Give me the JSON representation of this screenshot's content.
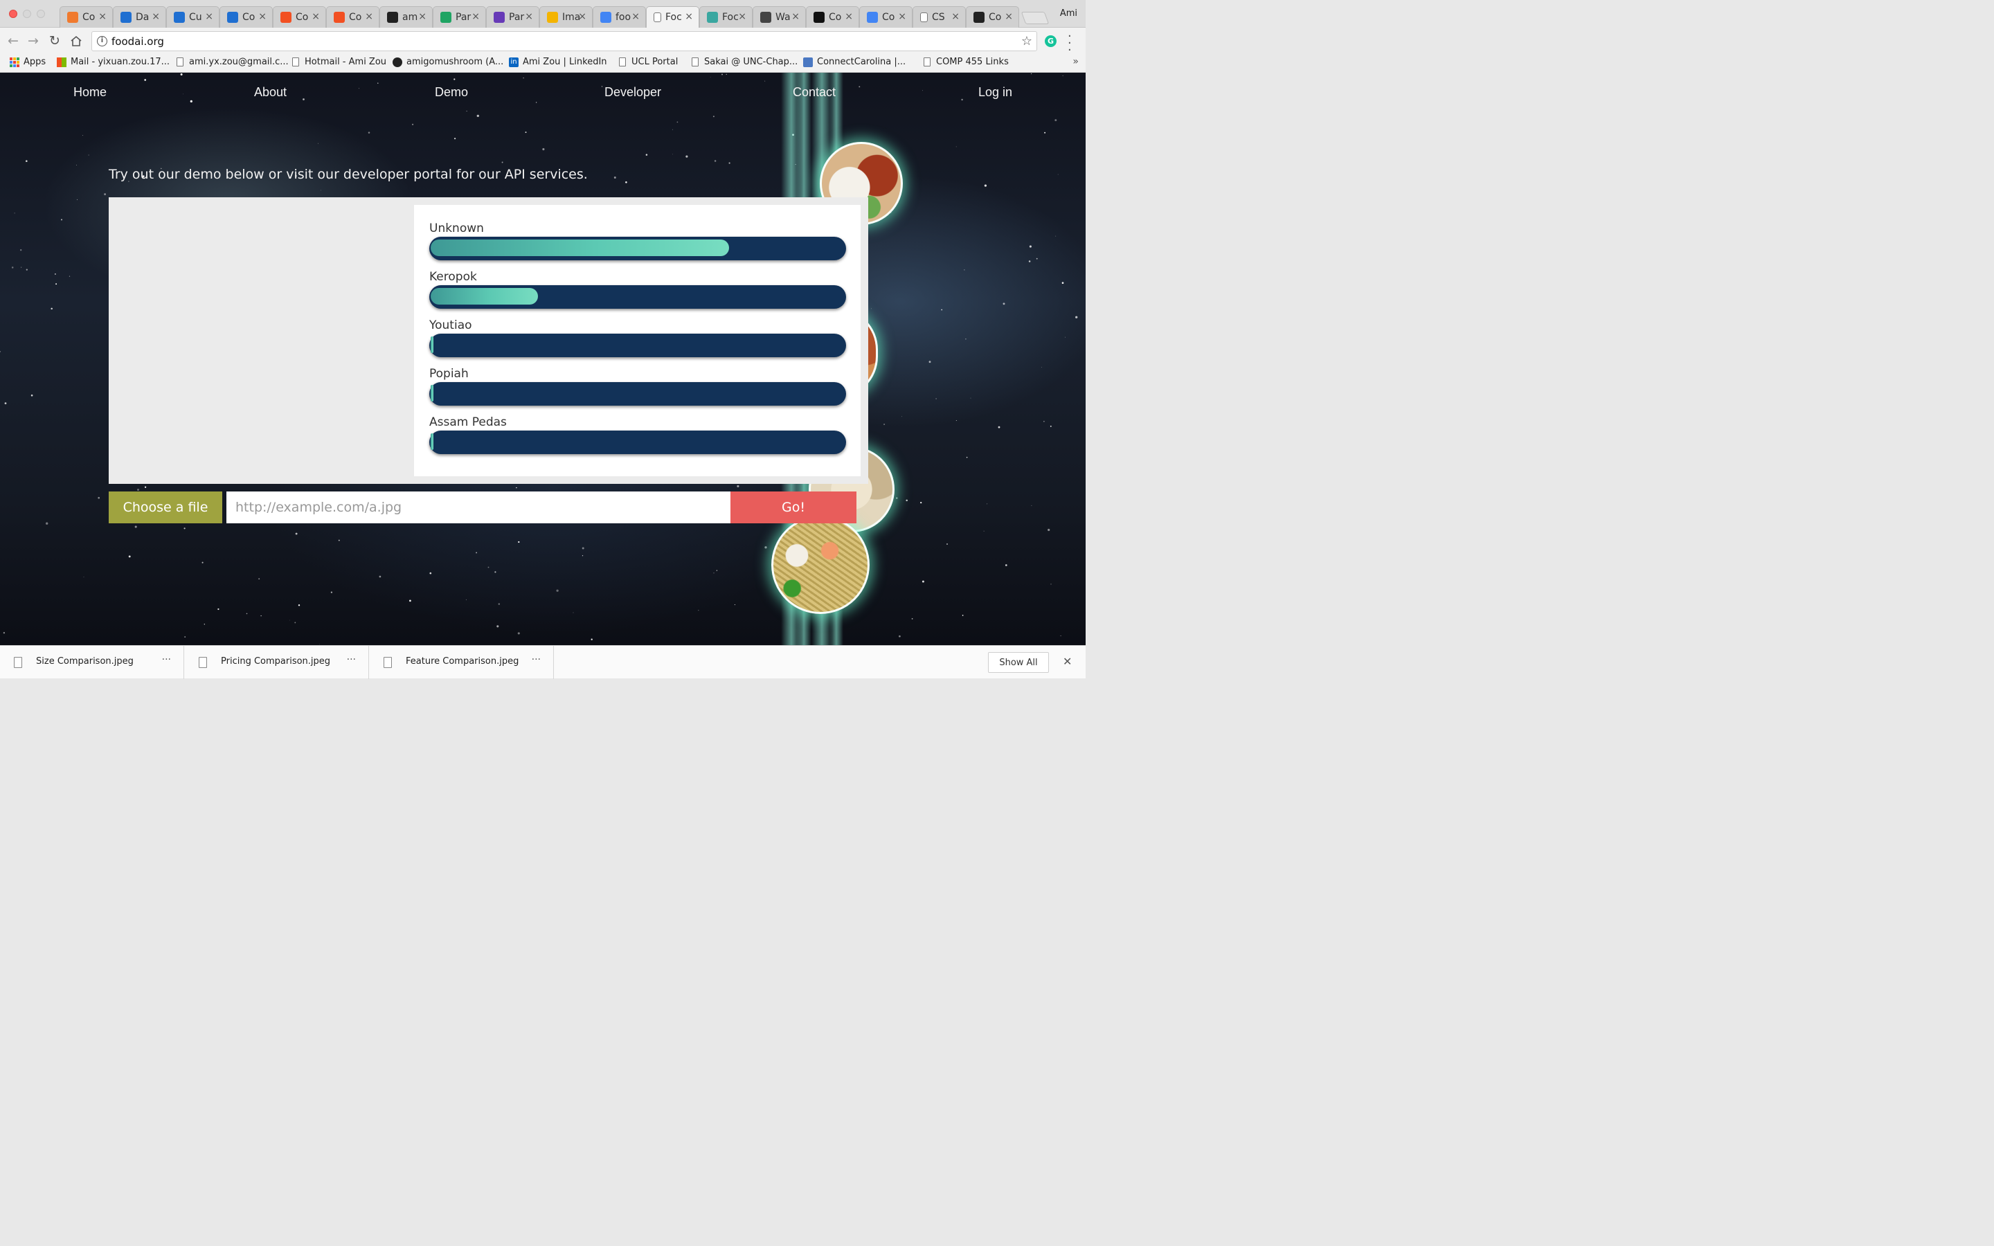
{
  "browser": {
    "profile_name": "Ami",
    "tabs": [
      {
        "title": "Co",
        "favicon": "orange-ring-icon",
        "color": "#f07a2e"
      },
      {
        "title": "Da",
        "favicon": "azure-icon",
        "color": "#1f6fd1"
      },
      {
        "title": "Cu",
        "favicon": "custom-vision-icon",
        "color": "#1f6fd1"
      },
      {
        "title": "Co",
        "favicon": "azure-icon",
        "color": "#1f6fd1"
      },
      {
        "title": "Co",
        "favicon": "microsoft-icon",
        "color": "#f25022"
      },
      {
        "title": "Co",
        "favicon": "microsoft-icon",
        "color": "#f25022"
      },
      {
        "title": "am",
        "favicon": "github-icon",
        "color": "#222222"
      },
      {
        "title": "Par",
        "favicon": "google-drive-icon",
        "color": "#1fa463"
      },
      {
        "title": "Par",
        "favicon": "google-forms-icon",
        "color": "#673ab7"
      },
      {
        "title": "Ima",
        "favicon": "google-slides-icon",
        "color": "#f4b400"
      },
      {
        "title": "foo",
        "favicon": "google-icon",
        "color": "#4285f4"
      },
      {
        "title": "Foc",
        "favicon": "page-icon",
        "color": "#777777",
        "active": true
      },
      {
        "title": "Foc",
        "favicon": "bird-icon",
        "color": "#3aa7a0"
      },
      {
        "title": "Wa",
        "favicon": "bike-icon",
        "color": "#444444"
      },
      {
        "title": "Co",
        "favicon": "medium-icon",
        "color": "#111111"
      },
      {
        "title": "Co",
        "favicon": "google-icon",
        "color": "#4285f4"
      },
      {
        "title": "CS",
        "favicon": "page-icon",
        "color": "#777777"
      },
      {
        "title": "Co",
        "favicon": "wikipedia-icon",
        "color": "#222222"
      }
    ],
    "address": "foodai.org",
    "bookmarks": [
      {
        "label": "Apps",
        "icon": "apps-grid-icon"
      },
      {
        "label": "Mail - yixuan.zou.17...",
        "icon": "microsoft-icon"
      },
      {
        "label": "ami.yx.zou@gmail.c...",
        "icon": "page-icon"
      },
      {
        "label": "Hotmail - Ami Zou",
        "icon": "page-icon"
      },
      {
        "label": "amigomushroom (A...",
        "icon": "github-icon"
      },
      {
        "label": "Ami Zou | LinkedIn",
        "icon": "linkedin-icon"
      },
      {
        "label": "UCL Portal",
        "icon": "page-icon"
      },
      {
        "label": "Sakai @ UNC-Chap...",
        "icon": "page-icon"
      },
      {
        "label": "ConnectCarolina |...",
        "icon": "connectcarolina-icon"
      },
      {
        "label": "COMP 455 Links",
        "icon": "page-icon"
      }
    ],
    "bookmarks_more": "»"
  },
  "site": {
    "nav": [
      "Home",
      "About",
      "Demo",
      "Developer",
      "Contact",
      "Log in"
    ],
    "tagline": "Try out our demo below or visit our developer portal for our API services.",
    "results": [
      {
        "label": "Unknown",
        "confidence": 0.72
      },
      {
        "label": "Keropok",
        "confidence": 0.26
      },
      {
        "label": "Youtiao",
        "confidence": 0.0
      },
      {
        "label": "Popiah",
        "confidence": 0.0
      },
      {
        "label": "Assam Pedas",
        "confidence": 0.0
      }
    ],
    "choose_file_label": "Choose a file",
    "url_placeholder": "http://example.com/a.jpg",
    "go_label": "Go!",
    "colors": {
      "bar_track": "#123258",
      "bar_fill": "#5cc9b3",
      "choose_button": "#9fa33f",
      "go_button": "#e85d5b"
    }
  },
  "downloads": {
    "items": [
      "Size Comparison.jpeg",
      "Pricing Comparison.jpeg",
      "Feature Comparison.jpeg"
    ],
    "more_label": "···",
    "show_all_label": "Show All",
    "close_label": "✕"
  }
}
